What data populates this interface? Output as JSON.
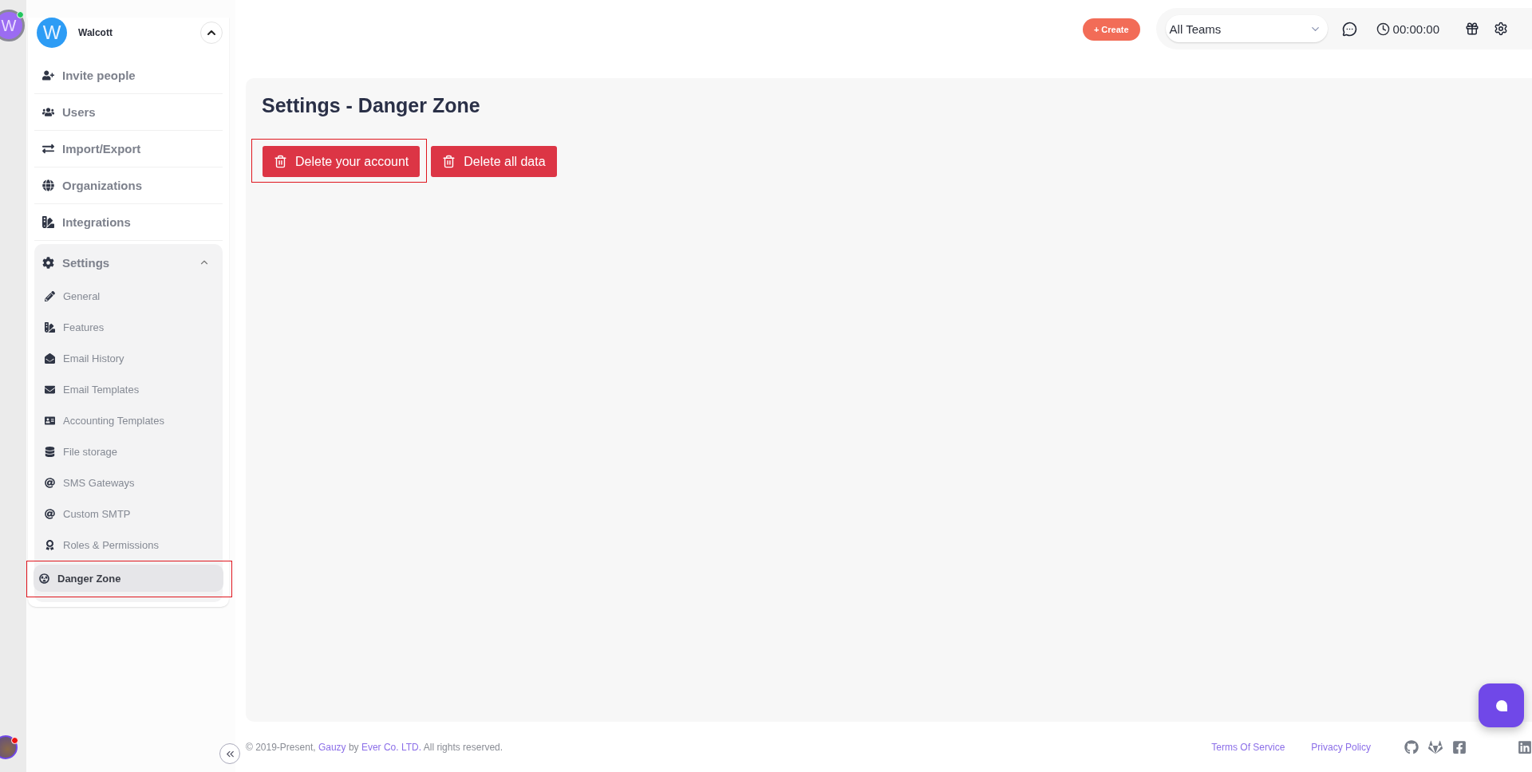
{
  "rail": {
    "avatar_letter": "W",
    "online": true,
    "user_notification": true
  },
  "workspace": {
    "avatar_letter": "W",
    "name": "Walcott",
    "expanded": true
  },
  "nav": [
    {
      "label": "Invite people"
    },
    {
      "label": "Users"
    },
    {
      "label": "Import/Export"
    },
    {
      "label": "Organizations"
    },
    {
      "label": "Integrations"
    },
    {
      "label": "Settings",
      "expanded": true,
      "children": [
        {
          "label": "General",
          "selected": false,
          "highlighted": false
        },
        {
          "label": "Features",
          "selected": false,
          "highlighted": false
        },
        {
          "label": "Email History",
          "selected": false,
          "highlighted": false
        },
        {
          "label": "Email Templates",
          "selected": false,
          "highlighted": false
        },
        {
          "label": "Accounting Templates",
          "selected": false,
          "highlighted": false
        },
        {
          "label": "File storage",
          "selected": false,
          "highlighted": false
        },
        {
          "label": "SMS Gateways",
          "selected": false,
          "highlighted": false
        },
        {
          "label": "Custom SMTP",
          "selected": false,
          "highlighted": false
        },
        {
          "label": "Roles & Permissions",
          "selected": false,
          "highlighted": false
        },
        {
          "label": "Danger Zone",
          "selected": true,
          "highlighted": true
        }
      ]
    }
  ],
  "header": {
    "create_button": "+ Create",
    "team_select": {
      "value": "All Teams"
    },
    "timer": "00:00:00"
  },
  "page": {
    "title": "Settings - Danger Zone",
    "actions": [
      {
        "label": "Delete your account",
        "highlighted": true
      },
      {
        "label": "Delete all data",
        "highlighted": false
      }
    ]
  },
  "footer": {
    "copyright": [
      {
        "kind": "text",
        "text": "© 2019-Present, "
      },
      {
        "kind": "link",
        "text": "Gauzy"
      },
      {
        "kind": "text",
        "text": " by "
      },
      {
        "kind": "link",
        "text": "Ever Co. LTD."
      },
      {
        "kind": "text",
        "text": " All rights reserved."
      }
    ],
    "links": [
      "Terms Of Service",
      "Privacy Policy"
    ]
  }
}
